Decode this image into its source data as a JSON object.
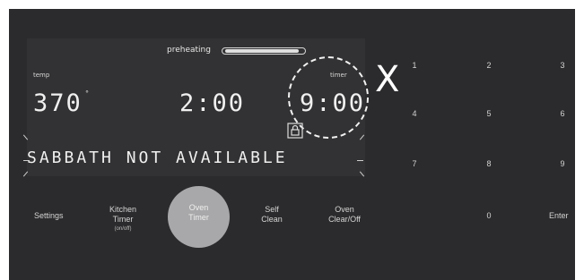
{
  "display": {
    "preheating_label": "preheating",
    "preheat_progress": 0.95,
    "temp_label": "temp",
    "temperature": "370",
    "degree_mark": "°",
    "clock": "2:00",
    "timer_label": "timer",
    "timer_value": "9:00",
    "message": "SABBATH NOT AVAILABLE"
  },
  "annotation": {
    "x_mark": "X"
  },
  "keys": {
    "settings": "Settings",
    "kitchen_timer_line1": "Kitchen",
    "kitchen_timer_line2": "Timer",
    "kitchen_timer_sub": "(on/off)",
    "oven_timer_line1": "Oven",
    "oven_timer_line2": "Timer",
    "self_clean_line1": "Self",
    "self_clean_line2": "Clean",
    "oven_clear_line1": "Oven",
    "oven_clear_line2": "Clear/Off",
    "enter": "Enter"
  },
  "numpad": [
    "1",
    "2",
    "3",
    "4",
    "5",
    "6",
    "7",
    "8",
    "9",
    "0"
  ],
  "colors": {
    "panel": "#2b2b2d",
    "display": "#323234",
    "active_button": "#a8a8aa"
  },
  "icons": {
    "lock": "lock-icon"
  }
}
